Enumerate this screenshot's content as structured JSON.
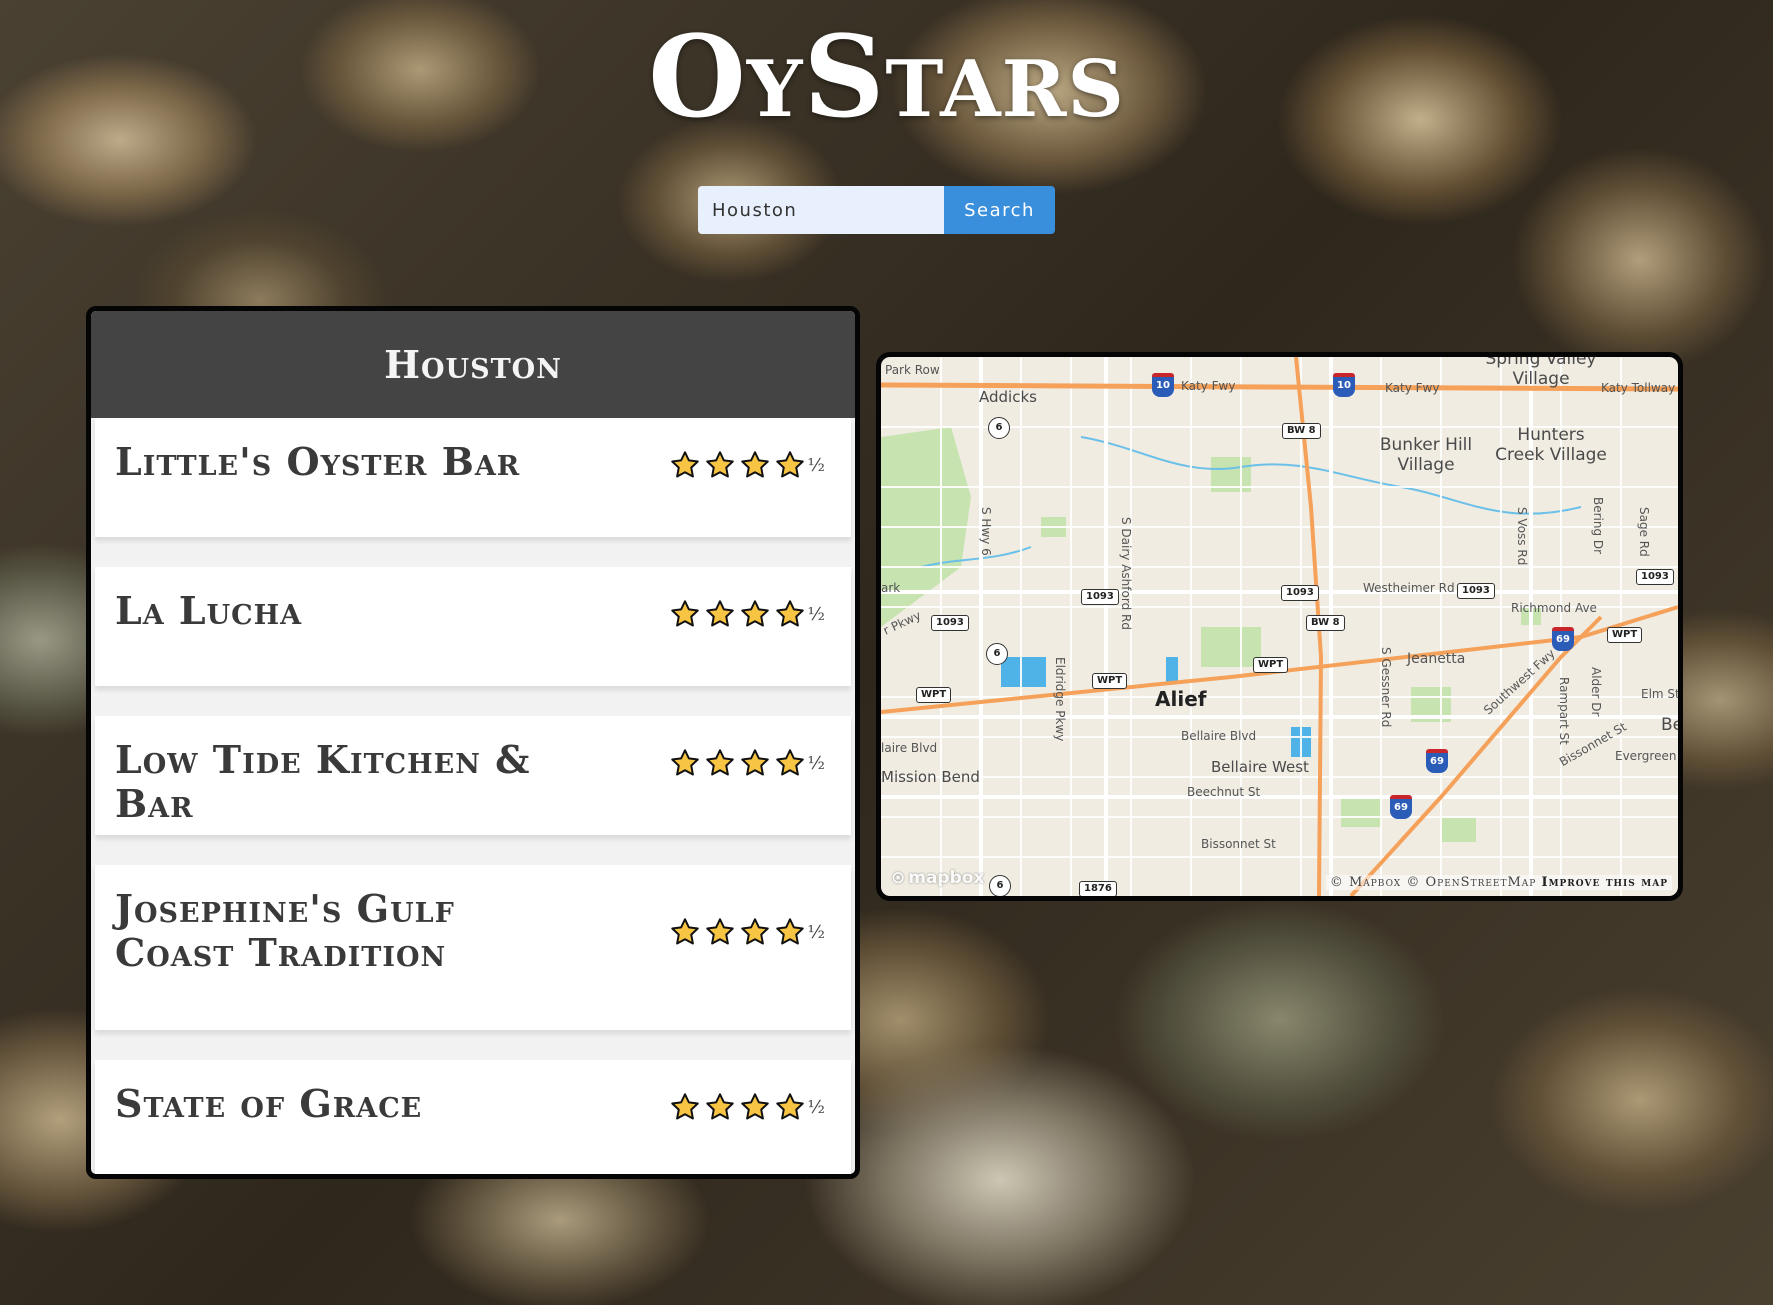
{
  "app": {
    "logo": "OyStars"
  },
  "search": {
    "value": "Houston",
    "button_label": "Search"
  },
  "list": {
    "header": "Houston",
    "restaurants": [
      {
        "name": "Little's Oyster Bar",
        "rating": 4.5,
        "half_label": "½"
      },
      {
        "name": "La Lucha",
        "rating": 4.5,
        "half_label": "½"
      },
      {
        "name": "Low Tide Kitchen & Bar",
        "rating": 4.5,
        "half_label": "½"
      },
      {
        "name": "Josephine's Gulf Coast Tradition",
        "rating": 4.5,
        "half_label": "½"
      },
      {
        "name": "State of Grace",
        "rating": 4.5,
        "half_label": "½"
      }
    ]
  },
  "map": {
    "places": {
      "park_row": "Park Row",
      "addicks": "Addicks",
      "spring_valley": "Spring Valley Village",
      "bunker_hill": "Bunker Hill Village",
      "hunters_creek": "Hunters Creek Village",
      "alief": "Alief",
      "bellaire_west": "Bellaire West",
      "mission_bend": "Mission Bend",
      "elm_st": "Elm St",
      "be": "Be",
      "evergreen": "Evergreen",
      "ark": "ark",
      "laire_blvd": "laire Blvd"
    },
    "roads": {
      "katy_fwy_1": "Katy Fwy",
      "katy_fwy_2": "Katy Fwy",
      "katy_tollway": "Katy Tollway",
      "s_hwy_6": "S Hwy 6",
      "s_dairy_ashford": "S Dairy Ashford Rd",
      "s_voss": "S Voss Rd",
      "bering": "Bering Dr",
      "sage": "Sage Rd",
      "westheimer": "Westheimer Rd",
      "richmond": "Richmond Ave",
      "jeanetta": "Jeanetta",
      "s_gessner": "S Gessner Rd",
      "southwest_fwy": "Southwest Fwy",
      "rampart": "Rampart St",
      "alder": "Alder Dr",
      "eldridge": "Eldridge Pkwy",
      "bellaire_blvd": "Bellaire Blvd",
      "beechnut": "Beechnut St",
      "bissonnet_1": "Bissonnet St",
      "bissonnet_2": "Bissonnet St",
      "r_pkwy": "r Pkwy"
    },
    "shields": {
      "i10": "10",
      "bw8": "BW 8",
      "s1093": "1093",
      "wpt": "WPT",
      "us69": "69",
      "s6": "6",
      "s1876": "1876"
    },
    "logo": "mapbox",
    "attribution": {
      "mapbox": "© Mapbox",
      "osm": "© OpenStreetMap",
      "improve": "Improve this map"
    }
  },
  "colors": {
    "header_bg": "#444444",
    "search_button": "#3a8fdc",
    "search_field": "#e8f0fe",
    "star_fill": "#f7c443",
    "freeway": "#f5a15a",
    "map_bg": "#f0ece2",
    "park": "#c6e3b0",
    "water": "#4fb3e8"
  }
}
